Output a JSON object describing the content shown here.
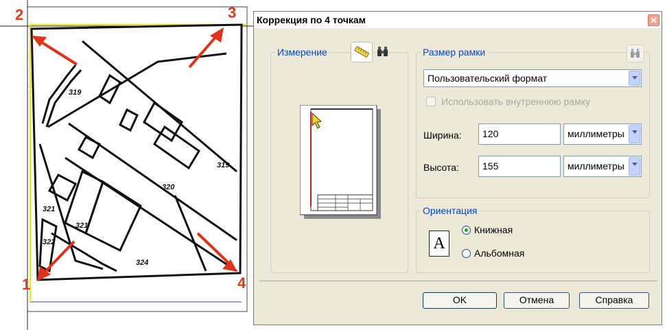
{
  "map": {
    "corner_labels": [
      "2",
      "3",
      "1",
      "4"
    ],
    "map_labels": [
      "319",
      "319",
      "320",
      "321",
      "321",
      "322",
      "324"
    ]
  },
  "dialog": {
    "title": "Коррекция по 4 точкам",
    "measurement": {
      "legend": "Измерение",
      "ruler_icon": "ruler-icon",
      "binoculars_icon": "binoculars-icon"
    },
    "frame_size": {
      "legend": "Размер рамки",
      "format_value": "Пользовательский формат",
      "use_inner_frame_label": "Использовать внутреннюю рамку",
      "use_inner_frame_checked": false,
      "width_label": "Ширина:",
      "width_value": "120",
      "width_unit": "миллиметры",
      "height_label": "Высота:",
      "height_value": "155",
      "height_unit": "миллиметры"
    },
    "orientation": {
      "legend": "Ориентация",
      "portrait_label": "Книжная",
      "landscape_label": "Альбомная",
      "selected": "portrait",
      "preview_glyph": "A"
    },
    "buttons": {
      "ok": "OK",
      "cancel": "Отмена",
      "help": "Справка"
    }
  }
}
